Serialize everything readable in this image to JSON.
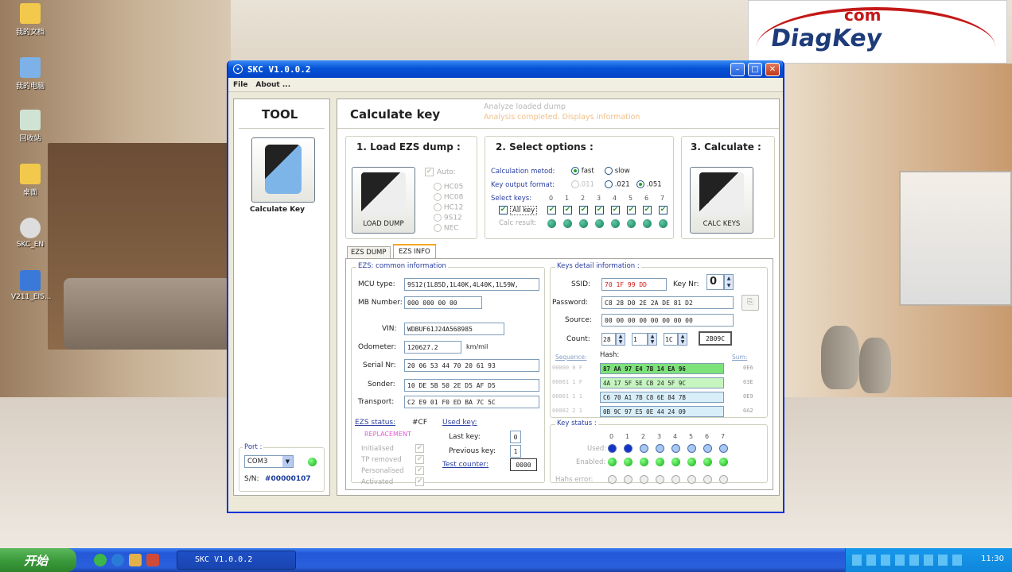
{
  "desktop": {
    "icons": [
      "我的文档",
      "我的电脑",
      "回收站",
      "桌面",
      "SKC_EN",
      "V211_EIS..."
    ]
  },
  "logo": {
    "top": "com",
    "main": "DiagKey"
  },
  "window": {
    "title": "SKC  V1.0.0.2",
    "menu": [
      "File",
      "About ..."
    ]
  },
  "tool": {
    "header": "TOOL",
    "calc_label": "Calculate Key",
    "port_label": "Port :",
    "port_value": "COM3",
    "sn_label": "S/N:",
    "sn_value": "#00000107"
  },
  "main": {
    "title": "Calculate key",
    "status_line1": "Analyze loaded dump",
    "status_line2": "Analysis completed. Displays information",
    "step1": {
      "title": "1. Load EZS dump :",
      "button": "LOAD DUMP",
      "auto": "Auto:",
      "options": [
        "HC05",
        "HC08",
        "HC12",
        "9S12",
        "NEC"
      ]
    },
    "step2": {
      "title": "2. Select options :",
      "calc_method_label": "Calculation metod:",
      "fast": "fast",
      "slow": "slow",
      "key_format_label": "Key output format:",
      "formats": [
        ".011",
        ".021",
        ".051"
      ],
      "select_keys_label": "Select keys:",
      "all_key": "All key",
      "calc_result_label": "Calc result:",
      "key_numbers": [
        "0",
        "1",
        "2",
        "3",
        "4",
        "5",
        "6",
        "7"
      ]
    },
    "step3": {
      "title": "3. Calculate :",
      "button": "CALC KEYS"
    }
  },
  "tabs": [
    "EZS DUMP",
    "EZS INFO"
  ],
  "ezs_info": {
    "group_title": "EZS: common information",
    "mcu_label": "MCU type:",
    "mcu_value": "9S12(1L85D,1L40K,4L40K,1L59W,",
    "mb_label": "MB Number:",
    "mb_value": "000 000 00 00",
    "vin_label": "VIN:",
    "vin_value": "WDBUF61J24A568985",
    "odo_label": "Odometer:",
    "odo_value": "120627.2",
    "odo_unit": "km/mil",
    "serial_label": "Serial Nr:",
    "serial_value": "20 06 53 44 70 20 61 93",
    "sonder_label": "Sonder:",
    "sonder_value": "10 DE 5B 50 2E D5 AF D5",
    "transport_label": "Transport:",
    "transport_value": "C2 E9 01 F0 ED BA 7C 5C",
    "status_label": "EZS status:",
    "status_code": "#CF",
    "replacement": "REPLACEMENT",
    "states": [
      "Initialised",
      "TP removed",
      "Personalised",
      "Activated"
    ],
    "used_key_label": "Used key:",
    "last_key_label": "Last key:",
    "last_key_value": "0",
    "prev_key_label": "Previous key:",
    "prev_key_value": "1",
    "test_counter_label": "Test counter:",
    "test_counter_value": "0000"
  },
  "keys_detail": {
    "group_title": "Keys detail information :",
    "ssid_label": "SSID:",
    "ssid_value": "70 1F 99 DD",
    "keynr_label": "Key Nr:",
    "keynr_value": "0",
    "password_label": "Password:",
    "password_value": "C8 28 D0 2E 2A DE 81 D2",
    "source_label": "Source:",
    "source_value": "00 00 00 00 00 00 00 00",
    "count_label": "Count:",
    "count_values": [
      "28",
      "1",
      "1C"
    ],
    "count_result": "2B09C",
    "seq_label": "Sequence:",
    "hash_label": "Hash:",
    "sum_label": "Sum:",
    "hash_rows": [
      {
        "seq": "00000 0 F",
        "hash": "87 AA 97 E4 7B 14 EA 96",
        "sum": "0E6"
      },
      {
        "seq": "00001 1 F",
        "hash": "4A 17 5F 5E CB 24 5F 9C",
        "sum": "03E"
      },
      {
        "seq": "00001 1 1",
        "hash": "C6 70 A1 7B C8 6E 84 7B",
        "sum": "0E9"
      },
      {
        "seq": "00002 2 1",
        "hash": "0B 9C 97 E5 0E 44 24 09",
        "sum": "0A2"
      }
    ]
  },
  "key_status": {
    "group_title": "Key status :",
    "numbers": [
      "0",
      "1",
      "2",
      "3",
      "4",
      "5",
      "6",
      "7"
    ],
    "used_label": "Used:",
    "enabled_label": "Enabled:",
    "hash_error_label": "Hahs error:"
  },
  "taskbar": {
    "start": "开始",
    "task": "SKC  V1.0.0.2",
    "clock": "11:30"
  }
}
